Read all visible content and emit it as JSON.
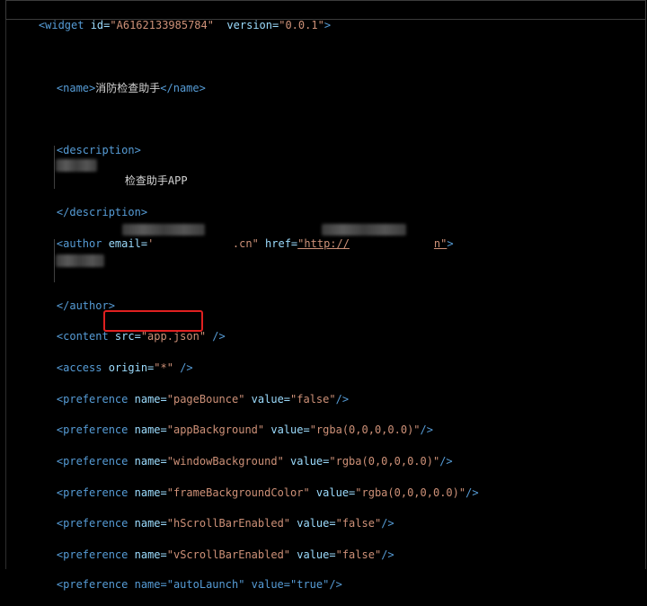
{
  "lines": {
    "widget": {
      "open": "<widget",
      "id_attr": " id=",
      "id_val": "\"A6162133985784\"",
      "ver_attr": "  version=",
      "ver_val": "\"0.0.1\"",
      "close": ">"
    },
    "name": {
      "open": "<name>",
      "text": "消防检查助手",
      "close": "</name>"
    },
    "description_open": "<description>",
    "description_text": "检查助手APP",
    "description_close": "</description>",
    "author": {
      "open": "<author",
      "email_attr": " email=",
      "email_q": "'",
      "email_tail": ".cn\"",
      "href_attr": " href=",
      "href_q": "\"http://",
      "href_tail": "n\"",
      "close": ">"
    },
    "author_close": "</author>",
    "content": {
      "open": "<content",
      "src_attr": " src=",
      "src_val": "\"app.json\"",
      "close": " />"
    },
    "access": {
      "open": "<access",
      "origin_attr": " origin=",
      "origin_val": "\"*\"",
      "close": " />"
    },
    "preferences": [
      {
        "name": "\"pageBounce\"",
        "value": "\"false\""
      },
      {
        "name": "\"appBackground\"",
        "value": "\"rgba(0,0,0,0.0)\""
      },
      {
        "name": "\"windowBackground\"",
        "value": "\"rgba(0,0,0,0.0)\""
      },
      {
        "name": "\"frameBackgroundColor\"",
        "value": "\"rgba(0,0,0,0.0)\""
      },
      {
        "name": "\"hScrollBarEnabled\"",
        "value": "\"false\""
      },
      {
        "name": "\"vScrollBarEnabled\"",
        "value": "\"false\""
      }
    ],
    "pref_tag": "<preference",
    "pref_name_attr": " name=",
    "pref_value_attr": " value=",
    "pref_close": "/>",
    "last_partial": "<preference name=\"autoLaunch\" value=\"true\"/>"
  }
}
